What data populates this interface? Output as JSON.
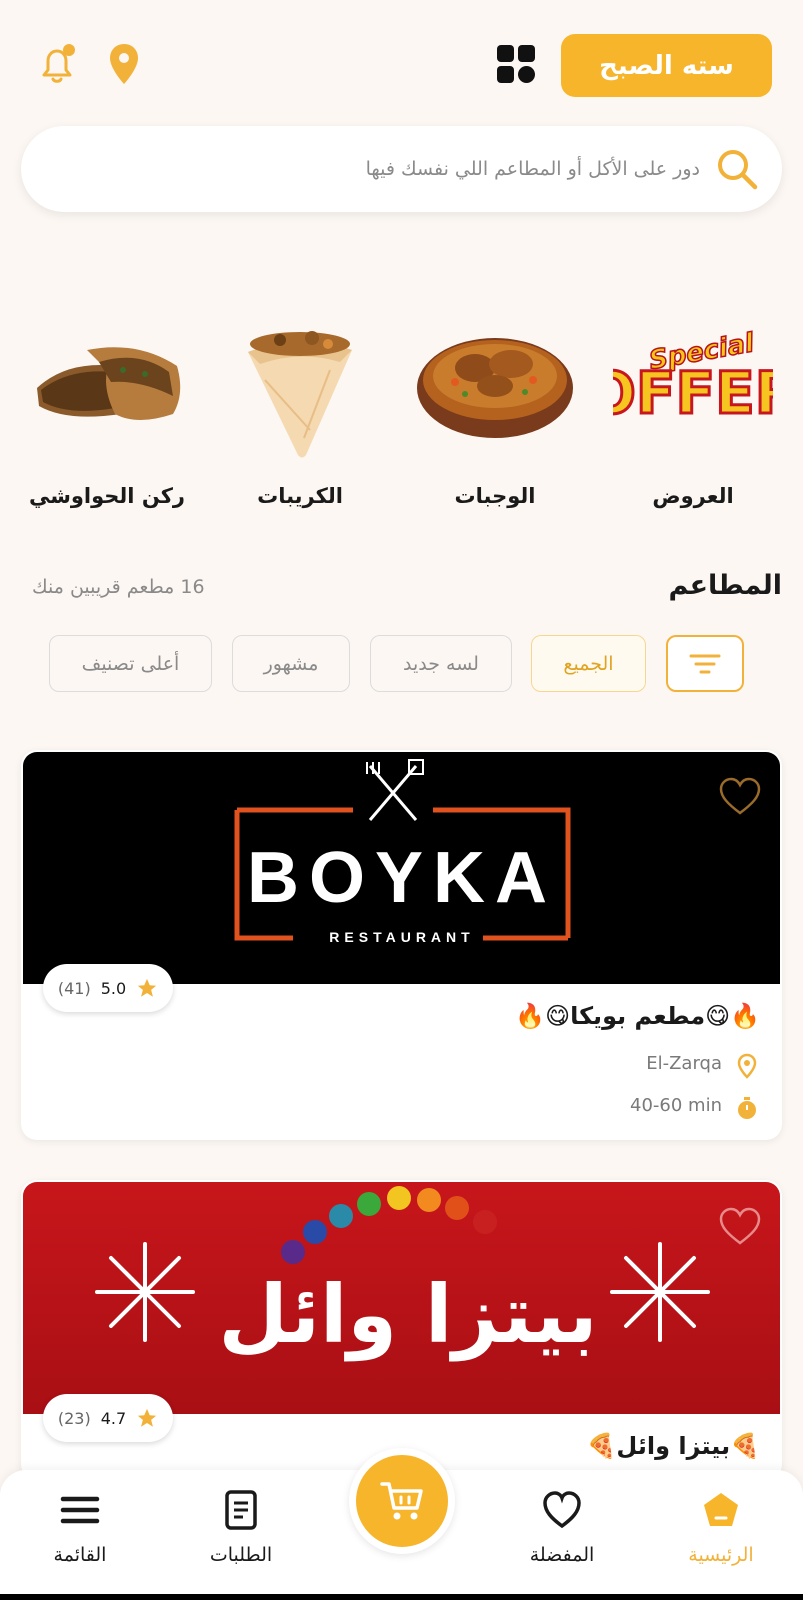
{
  "header": {
    "location_label": "سته الصبح"
  },
  "search": {
    "placeholder": "دور على الأكل أو المطاعم اللي نفسك فيها"
  },
  "categories": [
    {
      "label": "العروض",
      "icon": "special-offer-image"
    },
    {
      "label": "الوجبات",
      "icon": "meal-image"
    },
    {
      "label": "الكريبات",
      "icon": "crepe-image"
    },
    {
      "label": "ركن الحواوشي",
      "icon": "hawawshi-image"
    }
  ],
  "restaurants_section": {
    "title": "المطاعم",
    "count_text": "16 مطعم قريبين منك"
  },
  "filters": [
    {
      "label": "الجميع",
      "active": true
    },
    {
      "label": "لسه جديد",
      "active": false
    },
    {
      "label": "مشهور",
      "active": false
    },
    {
      "label": "أعلى تصنيف",
      "active": false
    }
  ],
  "restaurants": [
    {
      "name": "🔥😋مطعم بويكا😋🔥",
      "banner_brand": "BOYKA",
      "banner_sub": "RESTAURANT",
      "rating": "5.0",
      "reviews": "(41)",
      "location": "El-Zarqa",
      "delivery_time": "40-60 min"
    },
    {
      "name": "🍕بيتزا وائل🍕",
      "banner_brand": "بيتزا وائل",
      "rating": "4.7",
      "reviews": "(23)"
    }
  ],
  "bottom_nav": [
    {
      "label": "الرئيسية",
      "icon": "home-icon",
      "active": true
    },
    {
      "label": "المفضلة",
      "icon": "heart-icon",
      "active": false
    },
    {
      "label": "الطلبات",
      "icon": "orders-icon",
      "active": false
    },
    {
      "label": "القائمة",
      "icon": "menu-icon",
      "active": false
    }
  ],
  "colors": {
    "accent": "#f7b52c",
    "background": "#fcf7f3"
  }
}
